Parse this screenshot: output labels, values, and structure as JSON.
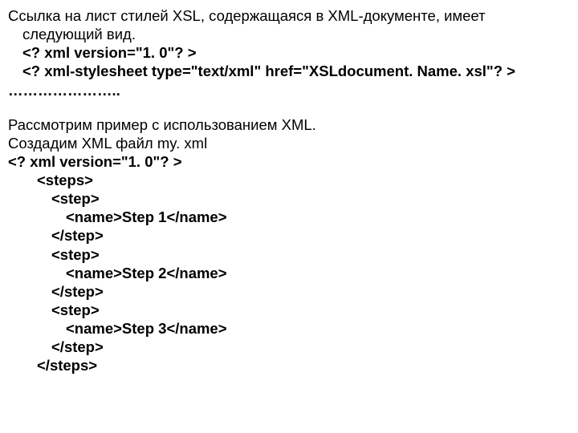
{
  "p1": {
    "l1": "Ссылка на лист стилей XSL, содержащаяся в XML-документе, имеет",
    "l2": "следующий вид.",
    "l3": "<? xml version=\"1. 0\"? >",
    "l4": "<? xml-stylesheet type=\"text/xml\"  href=\"XSLdocument. Name. xsl\"? >",
    "l5": "………………….."
  },
  "p2": {
    "l1": "Рассмотрим пример с использованием XML.",
    "l2": "Создадим XML файл my. xml",
    "l3": "<? xml version=\"1. 0\"? >",
    "l4": "<steps>",
    "l5": "<step>",
    "l6": "<name>Step 1</name>",
    "l7": "</step>",
    "l8": "<step>",
    "l9": "<name>Step 2</name>",
    "l10": "</step>",
    "l11": "<step>",
    "l12": "<name>Step 3</name>",
    "l13": "</step>",
    "l14": "</steps>"
  }
}
